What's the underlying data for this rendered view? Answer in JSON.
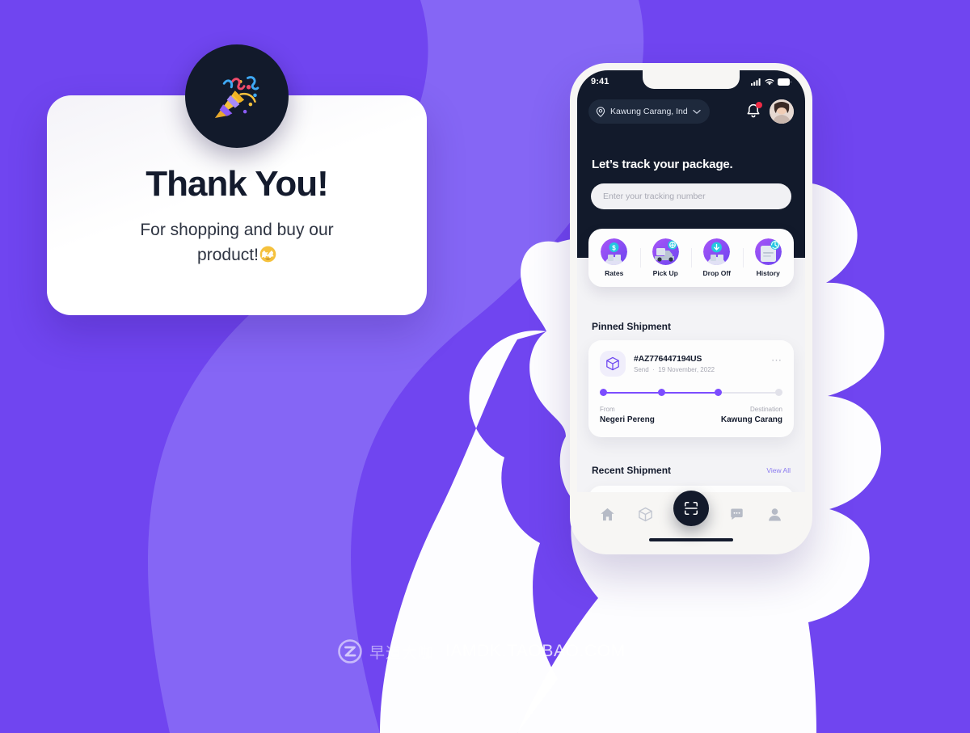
{
  "colors": {
    "background": "#7045f0",
    "background_wave": "#8566f5",
    "card_white": "#ffffff",
    "dark_navy": "#121a2b",
    "accent_purple": "#7c4dff",
    "link_purple": "#8a7af0",
    "notification_red": "#ef2b45",
    "hand_white": "#ffffff"
  },
  "thank_you_card": {
    "badge_icon": "party-popper-emoji",
    "title": "Thank You!",
    "subtitle_line1": "For shopping and buy our",
    "subtitle_line2": "product!",
    "subtitle_emoji": "star-struck-emoji"
  },
  "phone": {
    "status_bar": {
      "time": "9:41",
      "icons": [
        "cellular-signal-icon",
        "wifi-icon",
        "battery-icon"
      ]
    },
    "top_bar": {
      "location_icon": "location-pin-icon",
      "location": "Kawung Carang, Ind",
      "chevron_icon": "chevron-down-icon",
      "bell_icon": "bell-icon",
      "has_notification": true,
      "avatar": "user-avatar"
    },
    "headline": "Let’s track your package.",
    "search": {
      "placeholder": "Enter your tracking number",
      "value": ""
    },
    "quick_actions": [
      {
        "label": "Rates",
        "icon": "rates-dollar-icon"
      },
      {
        "label": "Pick Up",
        "icon": "pickup-truck-icon"
      },
      {
        "label": "Drop Off",
        "icon": "dropoff-arrow-icon"
      },
      {
        "label": "History",
        "icon": "history-clock-icon"
      }
    ],
    "pinned_section": {
      "title": "Pinned Shipment",
      "card": {
        "icon": "package-box-icon",
        "tracking_number": "#AZ776447194US",
        "type": "Send",
        "separator": "·",
        "date": "19 November, 2022",
        "more_icon": "more-horizontal-icon",
        "progress_steps": 4,
        "progress_completed": 3,
        "from_label": "From",
        "from_value": "Negeri Pereng",
        "destination_label": "Destination",
        "destination_value": "Kawung Carang"
      }
    },
    "recent_section": {
      "title": "Recent Shipment",
      "view_all": "View All"
    },
    "bottom_nav": [
      {
        "icon": "home-icon",
        "active": false
      },
      {
        "icon": "package-icon",
        "active": false
      },
      {
        "icon": "scan-icon",
        "active": true
      },
      {
        "icon": "chat-icon",
        "active": false
      },
      {
        "icon": "profile-icon",
        "active": false
      }
    ]
  },
  "watermark": {
    "logo": "z-circle-logo",
    "chinese_text": "早道大咖",
    "url": "IAMDK.TAOBAO.COM"
  }
}
